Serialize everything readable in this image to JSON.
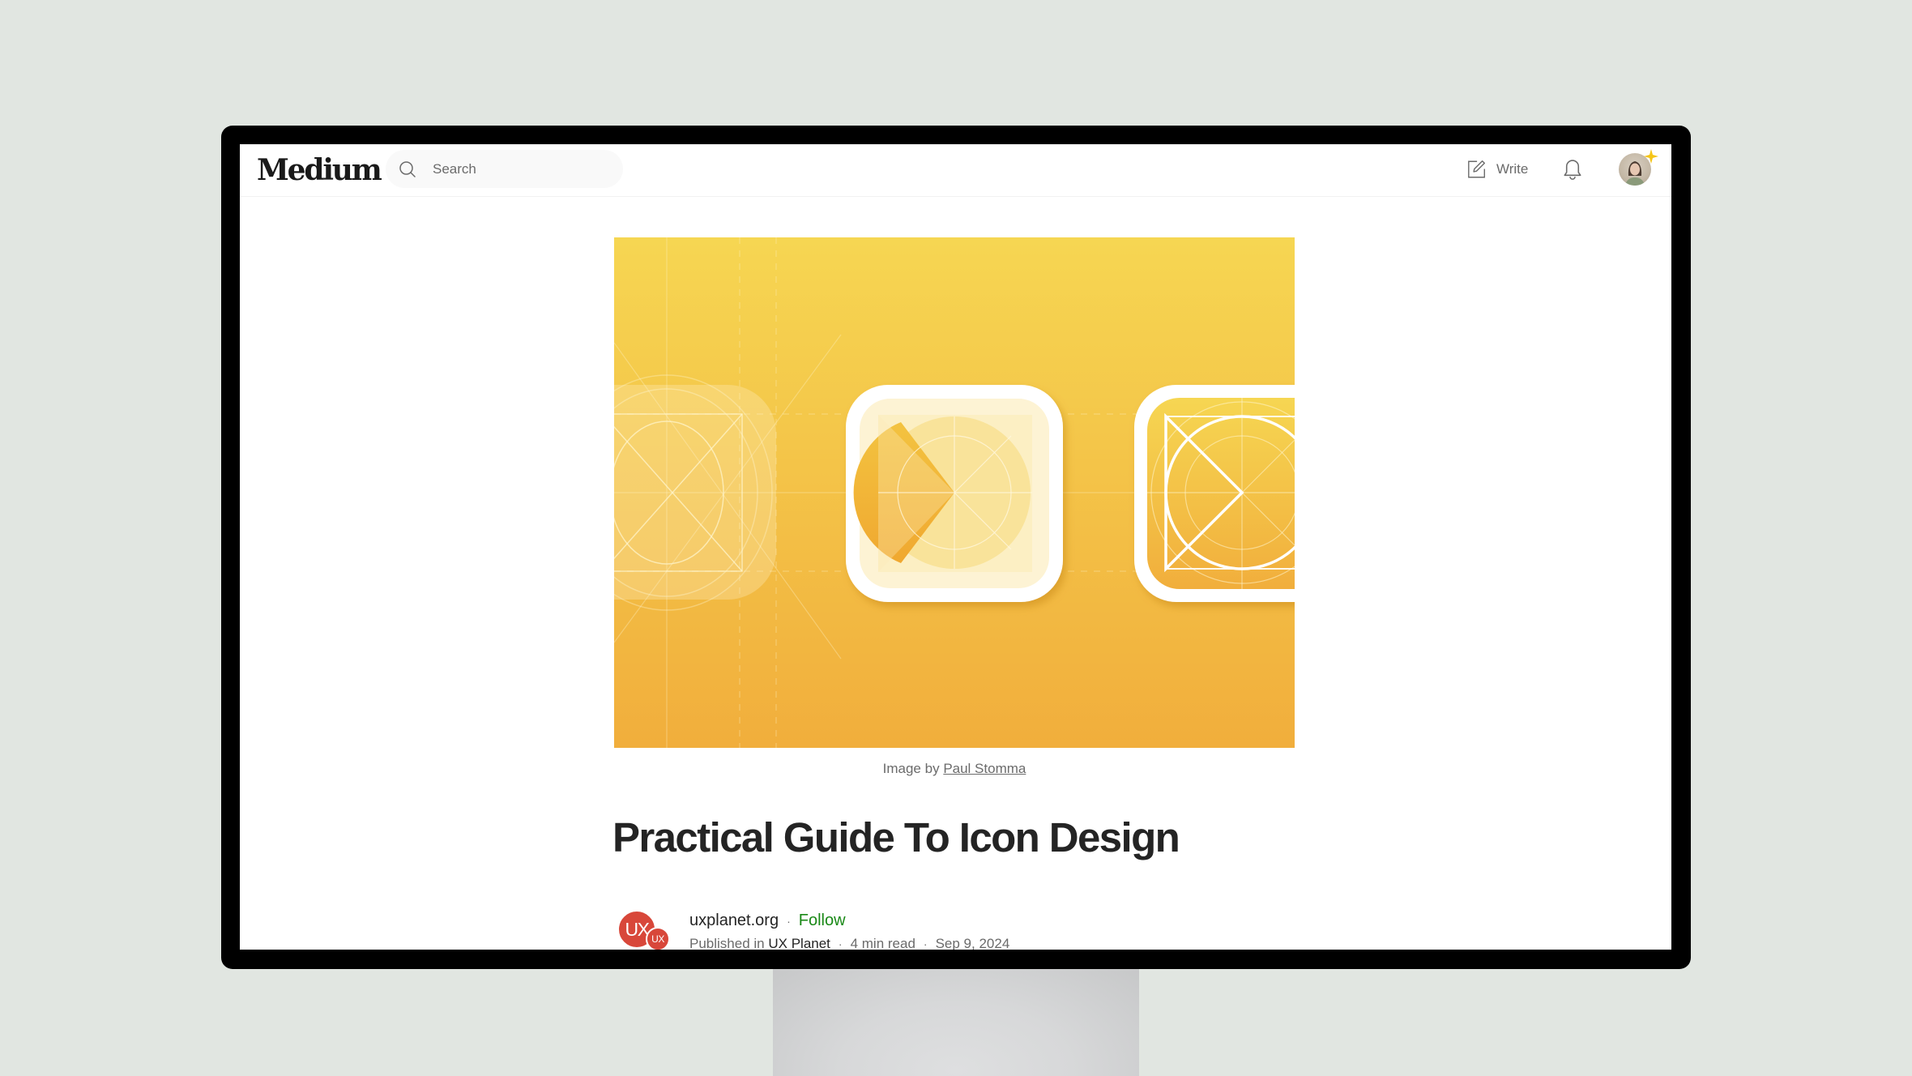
{
  "header": {
    "logo": "Medium",
    "search_placeholder": "Search",
    "write_label": "Write",
    "icons": {
      "search": "search-icon",
      "write": "pencil-square-icon",
      "notifications": "bell-icon",
      "avatar": "user-avatar",
      "membership": "sparkle-star-icon"
    }
  },
  "article": {
    "hero_image": {
      "description": "Yellow gradient illustration showing three app icon construction grids",
      "colors": {
        "top": "#f6d652",
        "bottom": "#f1ae3c"
      }
    },
    "caption": {
      "prefix": "Image by",
      "credit_link": "Paul Stomma"
    },
    "title": "Practical Guide To Icon Design",
    "author": {
      "avatar_text": "UX",
      "badge_text": "UX",
      "name": "uxplanet.org",
      "follow_label": "Follow",
      "separator": "·"
    },
    "meta": {
      "published_prefix": "Published in",
      "publication": "UX Planet",
      "read_time": "4 min read",
      "date": "Sep 9, 2024",
      "separator": "·"
    }
  },
  "colors": {
    "accent_follow": "#1a8917",
    "publication_red": "#d8473a",
    "text_primary": "#242424",
    "text_secondary": "#6b6b6b",
    "membership_star": "#f5c518"
  }
}
